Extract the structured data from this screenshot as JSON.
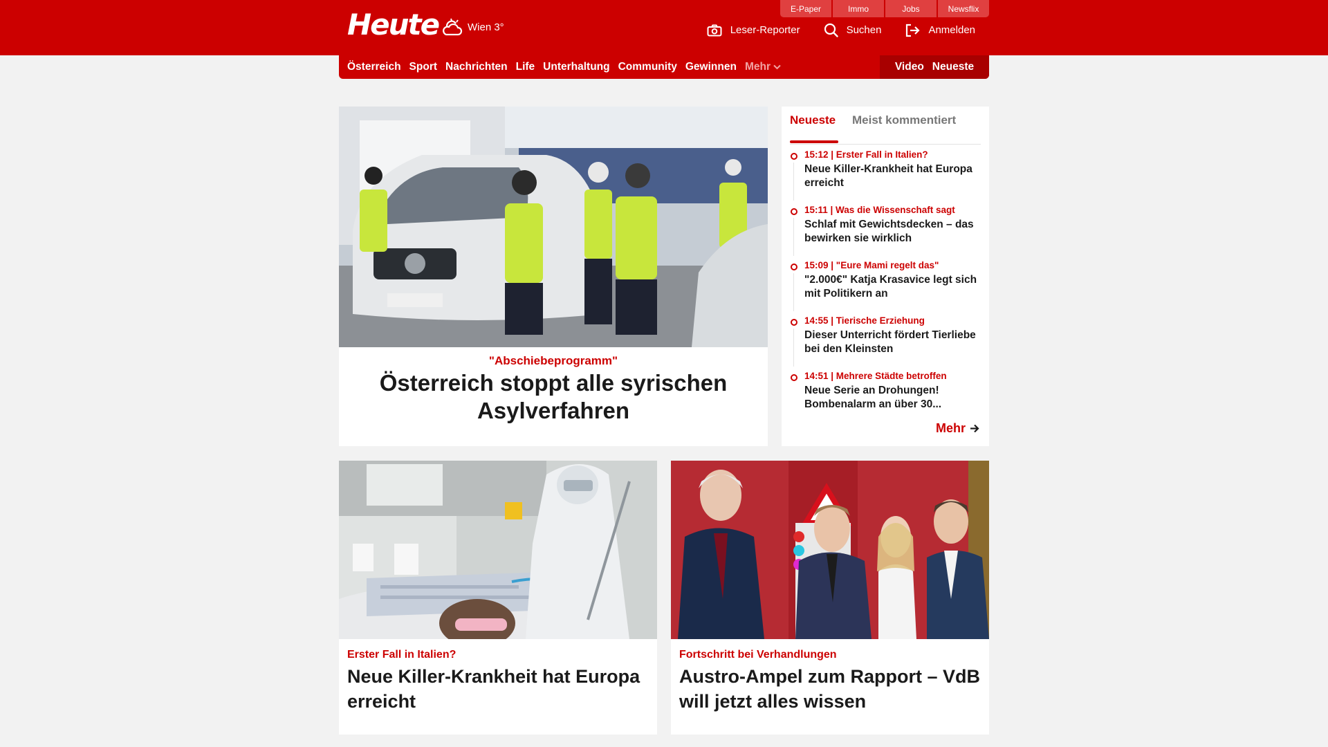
{
  "header": {
    "logo": "Heute",
    "weather": "Wien 3°",
    "service_links": [
      "E-Paper",
      "Immo",
      "Jobs",
      "Newsflix"
    ],
    "actions": {
      "reporter": "Leser-Reporter",
      "search": "Suchen",
      "login": "Anmelden"
    },
    "brand_color": "#cc0000"
  },
  "nav": {
    "items": [
      "Österreich",
      "Sport",
      "Nachrichten",
      "Life",
      "Unterhaltung",
      "Community",
      "Gewinnen"
    ],
    "more": "Mehr",
    "right": [
      "Video",
      "Neueste"
    ]
  },
  "hero": {
    "kicker": "\"Abschiebeprogramm\"",
    "title": "Österreich stoppt alle syrischen Asylverfahren",
    "image": "police-checkpoint-photo"
  },
  "sidebar": {
    "tabs": [
      "Neueste",
      "Meist kommentiert"
    ],
    "items": [
      {
        "meta": "15:12 | Erster Fall in Italien?",
        "headline": "Neue Killer-Krankheit hat Europa erreicht"
      },
      {
        "meta": "15:11 | Was die Wissenschaft sagt",
        "headline": "Schlaf mit Gewichtsdecken – das bewirken sie wirklich"
      },
      {
        "meta": "15:09 | \"Eure Mami regelt das\"",
        "headline": "\"2.000€\" Katja Krasavice legt sich mit Politikern an"
      },
      {
        "meta": "14:55 | Tierische Erziehung",
        "headline": "Dieser Unterricht fördert Tierliebe bei den Kleinsten"
      },
      {
        "meta": "14:51 | Mehrere Städte betroffen",
        "headline": "Neue Serie an Drohungen! Bombenalarm an über 30..."
      }
    ],
    "more": "Mehr"
  },
  "cards": [
    {
      "kicker": "Erster Fall in Italien?",
      "title": "Neue Killer-Krankheit hat Europa erreicht",
      "image": "hospital-patient-photo"
    },
    {
      "kicker": "Fortschritt bei Verhandlungen",
      "title": "Austro-Ampel zum Rapport – VdB will jetzt alles wissen",
      "image": "politicians-group-photo"
    }
  ]
}
